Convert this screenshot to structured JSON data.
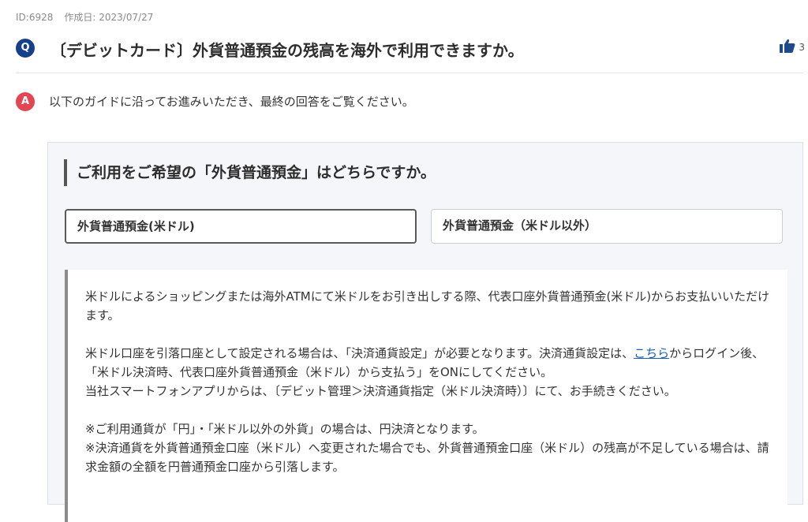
{
  "meta": {
    "id": "ID:6928",
    "created": "作成日: 2023/07/27"
  },
  "question": {
    "badge": "Q",
    "title": "〔デビットカード〕外貨普通預金の残高を海外で利用できますか。",
    "likes": "3",
    "like_icon": "thumbs-up-icon"
  },
  "answer": {
    "badge": "A",
    "intro": "以下のガイドに沿ってお進みいただき、最終の回答をご覧ください。"
  },
  "guide": {
    "title": "ご利用をご希望の「外貨普通預金」はどちらですか。",
    "options": [
      {
        "label": "外貨普通預金(米ドル)",
        "selected": true
      },
      {
        "label": "外貨普通預金（米ドル以外）",
        "selected": false
      }
    ],
    "result": {
      "p1": "米ドルによるショッピングまたは海外ATMにて米ドルをお引き出しする際、代表口座外貨普通預金(米ドル)からお支払いいただけます。",
      "p2_before_link": "米ドル口座を引落口座として設定される場合は、「決済通貨設定」が必要となります。決済通貨設定は、",
      "p2_link": "こちら",
      "p2_after_link": "からログイン後、「米ドル決済時、代表口座外貨普通預金（米ドル）から支払う」をONにしてください。",
      "p2_line2": "当社スマートフォンアプリからは、〔デビット管理＞決済通貨指定（米ドル決済時）〕にて、お手続きください。",
      "p3_line1": "※ご利用通貨が「円」・「米ドル以外の外貨」の場合は、円決済となります。",
      "p3_line2": "※決済通貨を外貨普通預金口座（米ドル）へ変更された場合でも、外貨普通預金口座（米ドル）の残高が不足している場合は、請求金額の全額を円普通預金口座から引落します。"
    }
  },
  "colors": {
    "q_badge": "#16408c",
    "a_badge": "#e34652",
    "link": "#1a5fb4",
    "thumb": "#1e4a8c"
  }
}
